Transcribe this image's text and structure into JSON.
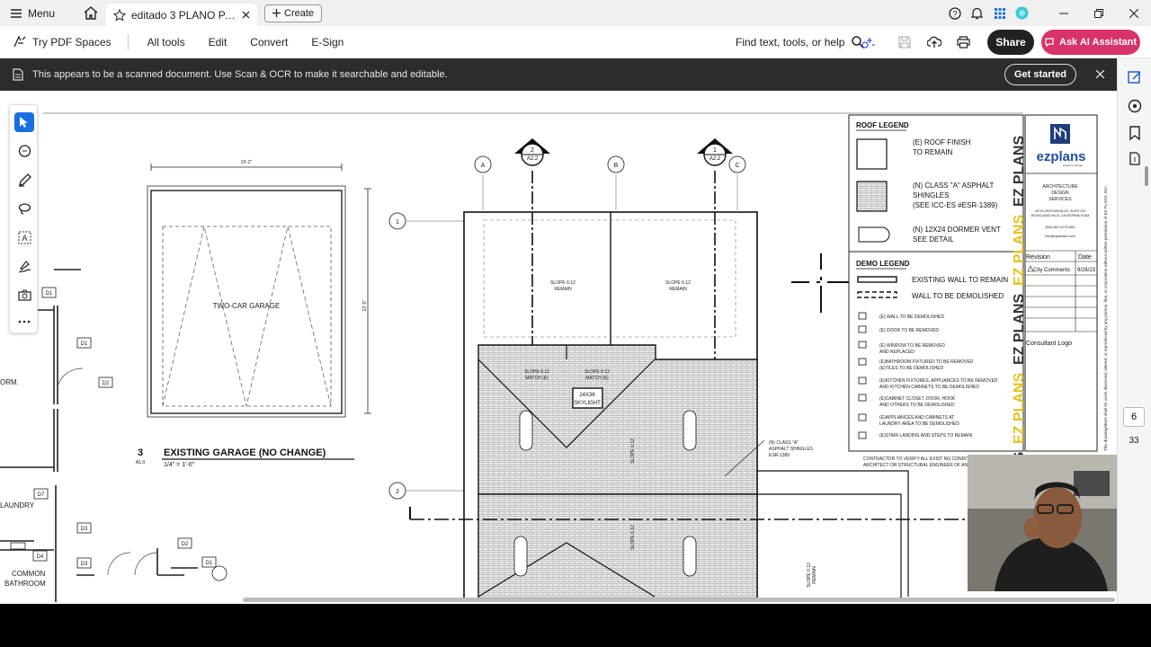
{
  "titlebar": {
    "menu_label": "Menu",
    "tab_title": "editado 3 PLANO PARA L...",
    "create_label": "Create"
  },
  "toolbar": {
    "pdf_spaces": "Try PDF Spaces",
    "all_tools": "All tools",
    "edit": "Edit",
    "convert": "Convert",
    "esign": "E-Sign",
    "find_placeholder": "Find text, tools, or help",
    "share": "Share",
    "ask_ai": "Ask AI Assistant"
  },
  "banner": {
    "message": "This appears to be a scanned document. Use Scan & OCR to make it searchable and editable.",
    "get_started": "Get started"
  },
  "page_nav": {
    "current": "6",
    "total": "33"
  },
  "drawing": {
    "garage_width_dim": "19'-2\"",
    "garage_depth_dim": "22'-5\"",
    "garage_label": "TWO-CAR GARAGE",
    "detail_number": "3",
    "detail_title": "EXISTING GARAGE (NO CHANGE)",
    "detail_scale": "1/4\" = 1'-0\"",
    "detail_sheet": "A1.0",
    "grid_a": "A",
    "grid_b": "B",
    "grid_c": "C",
    "grid_1": "1",
    "grid_2": "2",
    "section_1_num": "2",
    "section_1_sheet": "A2.2",
    "section_2_num": "1",
    "section_2_sheet": "A2.2",
    "slope_left": "SLOPE 6:12",
    "slope_right": "SLOPE 6:12",
    "remain": "REMAIN",
    "slope_match_left": "SLOPE 6:12",
    "slope_match_right": "SLOPE 6:12",
    "match_e": "MATCH (E)",
    "skylight_size": "24X36",
    "skylight_label": "SKYLIGHT",
    "slope_center": "SLOPE 6:12",
    "shingle_note_1": "(N) CLASS \"A\"",
    "shingle_note_2": "ASPHALT SHINGLES",
    "shingle_note_3": "ESR-1389",
    "contractor_note_1": "CONTRACTOR TO VERIFY ALL EXIST NG CONDITION",
    "contractor_note_2": "ARCHITECT OR STRUCTURAL ENGINEER OF ANY DI",
    "room_form": "ORM.",
    "room_laundry": "LAUNDRY",
    "room_common": "COMMON",
    "room_bathroom": "BATHROOM",
    "tag_d1": "D1",
    "tag_d2": "D2",
    "tag_d3": "D3",
    "tag_d4": "D4",
    "tag_d7": "D7"
  },
  "roof_legend": {
    "title": "ROOF LEGEND",
    "item1_a": "(E) ROOF FINISH",
    "item1_b": "TO REMAIN",
    "item2_a": "(N) CLASS \"A\" ASPHALT",
    "item2_b": "SHINGLES",
    "item2_c": "(SEE ICC-ES #ESR-1389)",
    "item3_a": "(N) 12X24 DORMER VENT",
    "item3_b": "SEE DETAIL"
  },
  "demo_legend": {
    "title": "DEMO LEGEND",
    "wall_remain": "EXISTING WALL TO REMAIN",
    "wall_demo": "WALL TO BE DEMOLISHED",
    "items": [
      "(E) WALL TO BE DEMOLISHED",
      "(E) DOOR TO BE REMOVED",
      "(E) WINDOW TO BE REMOVED",
      "AND REPLACED",
      "(E)BATHROOM FIXTURED TO BE REMOVED",
      "(E)TILES TO BE DEMOLISHED",
      "(E)KITCHEN FIXTURES, APPLIANCES TO BE REMOVED",
      "AND KITCHEN CABINETS TO BE DEMOLISHED",
      "(E)CABINET CLOSET, DOOR, HOOK",
      "AND OTHERS TO BE DEMOLISHED",
      "(E)APPLIANCES AND CABINETS AT",
      "LAUNDRY AREA TO BE DEMOLISHED",
      "(E)STAIR LANDING AND STEPS TO REMAIN"
    ]
  },
  "title_block": {
    "brand": "ezplans",
    "brand_sub": "simple by design",
    "services_1": "ARCHITECTURE",
    "services_2": "DESIGN",
    "services_3": "SERVICES",
    "address_1": "20720 VENTURA BLVD. SUITE 220",
    "address_2": "WOODLAND HILLS, CALIFORNIA 91364",
    "phone": "(818) 881-EZ-PLANS",
    "email": "info@ezplansinc.com",
    "revision_header": "Revision",
    "date_header": "Date",
    "rev1": "City Comments",
    "rev1_date": "9/26/23",
    "consultant": "Consultant Logo",
    "vertical_brand": "EZ PLANS",
    "copyright": "This drawing/sheet shall be used, disclosed, altered, or reproduced by any person, firm, or corporation without written permission of EZ PLANS, INC."
  }
}
